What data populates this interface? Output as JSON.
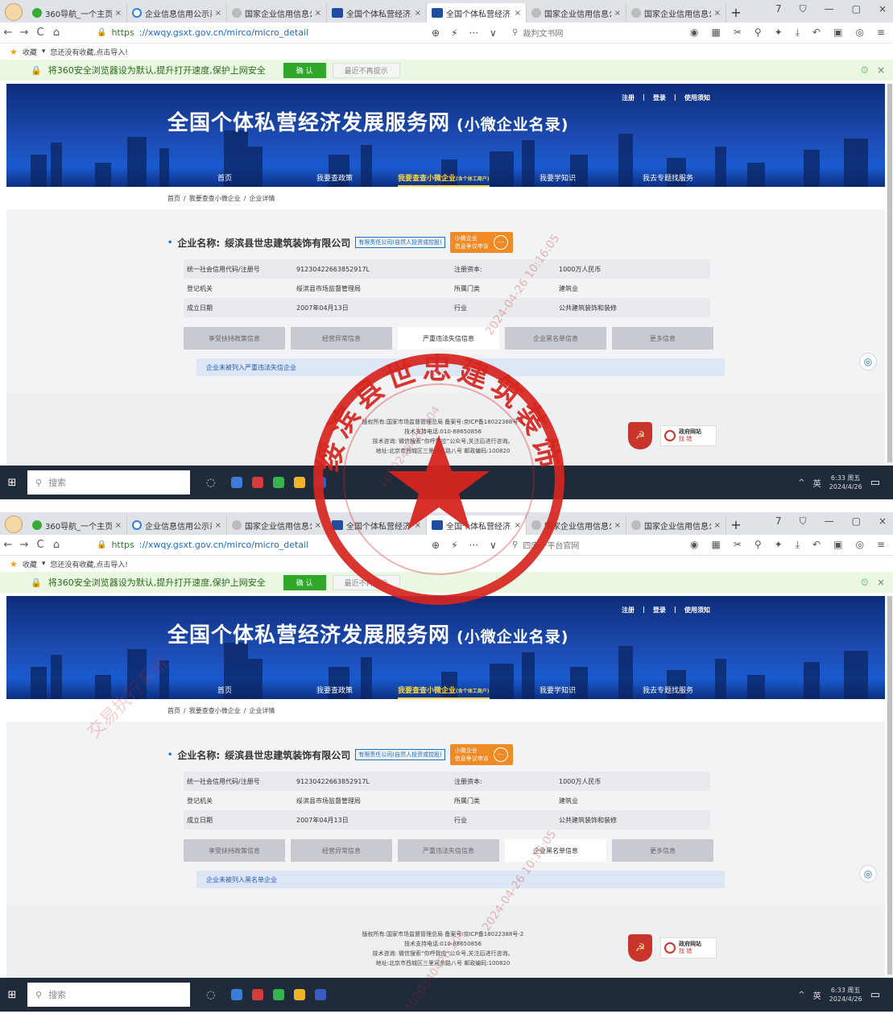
{
  "tabs": [
    {
      "label": "360导航_一个主页,",
      "icon": "360-icon"
    },
    {
      "label": "企业信息信用公示系",
      "icon": "search-icon"
    },
    {
      "label": "国家企业信用信息公",
      "icon": "globe-icon"
    },
    {
      "label": "全国个体私营经济发",
      "icon": "gsxt-icon"
    },
    {
      "label": "全国个体私营经济发",
      "icon": "gsxt-icon"
    },
    {
      "label": "国家企业信用信息公",
      "icon": "globe-icon"
    },
    {
      "label": "国家企业信用信息公",
      "icon": "globe-icon"
    }
  ],
  "url_scheme": "https",
  "url_rest": "://xwqy.gsxt.gov.cn/mirco/micro_detail",
  "search_placeholder_1": "裁判文书网",
  "search_placeholder_2": "四库一平台官网",
  "bookmarks": {
    "fav": "收藏",
    "tip": "您还没有收藏,点击导入!"
  },
  "notice": {
    "text": "将360安全浏览器设为默认,提升打开速度,保护上网安全",
    "ok": "确 认",
    "later": "最近不再提示"
  },
  "hero": {
    "title": "全国个体私营经济发展服务网",
    "subtitle": "(小微企业名录)",
    "links": [
      "注册",
      "登录",
      "使用须知"
    ],
    "menu": [
      "首页",
      "我要查政策",
      "我要查查小微企业",
      "(含个体工商户)",
      "我要学知识",
      "我去专题找服务"
    ]
  },
  "breadcrumb": [
    "首页",
    "我要查查小微企业",
    "企业详情"
  ],
  "company": {
    "label": "企业名称:",
    "name": "绥滨县世忠建筑装饰有限公司",
    "type": "有限责任公司(自然人投资或控股)",
    "appeal_1": "小微企业",
    "appeal_2": "信息争议申诉"
  },
  "info_rows": [
    {
      "k1": "统一社会信用代码/注册号",
      "v1": "91230422663852917L",
      "k2": "注册资本:",
      "v2": "1000万人民币"
    },
    {
      "k1": "登记机关",
      "v1": "绥滨县市场监督管理局",
      "k2": "所属门类",
      "v2": "建筑业"
    },
    {
      "k1": "成立日期",
      "v1": "2007年04月13日",
      "k2": "行业",
      "v2": "公共建筑装饰和装修"
    }
  ],
  "sections": [
    "享受扶持政策信息",
    "经营异常信息",
    "严重违法失信信息",
    "企业黑名单信息",
    "更多信息"
  ],
  "result_1": "企业未被列入严重违法失信企业",
  "result_2": "企业未被列入黑名单企业",
  "footer_lines": [
    "版权所有:国家市场监督管理总局 备案号:京ICP备18022388号-2",
    "技术支持电话:010-88650856",
    "技术咨询: 微信搜索“你呼我应”公众号,关注后进行咨询。",
    "地址:北京市西城区三里河东路八号 邮政编码:100820"
  ],
  "gov_site": {
    "title": "政府网站",
    "sub": "找 错"
  },
  "taskbar": {
    "search": "搜索",
    "time": "6:33 周五",
    "date": "2024/4/26",
    "lang": "英"
  },
  "watermarks": {
    "system": "交易执行系统",
    "ts": "2024-04-26 10:16:05",
    "num": "1020240426 104"
  },
  "stamp": {
    "ring_text": "绥滨县世忠建筑装饰有限公司",
    "center": "★"
  },
  "colors": {
    "accent": "#1d6fbf",
    "stamp": "#d6251f",
    "appeal": "#f08a24",
    "notice_ok": "#30a72b"
  }
}
